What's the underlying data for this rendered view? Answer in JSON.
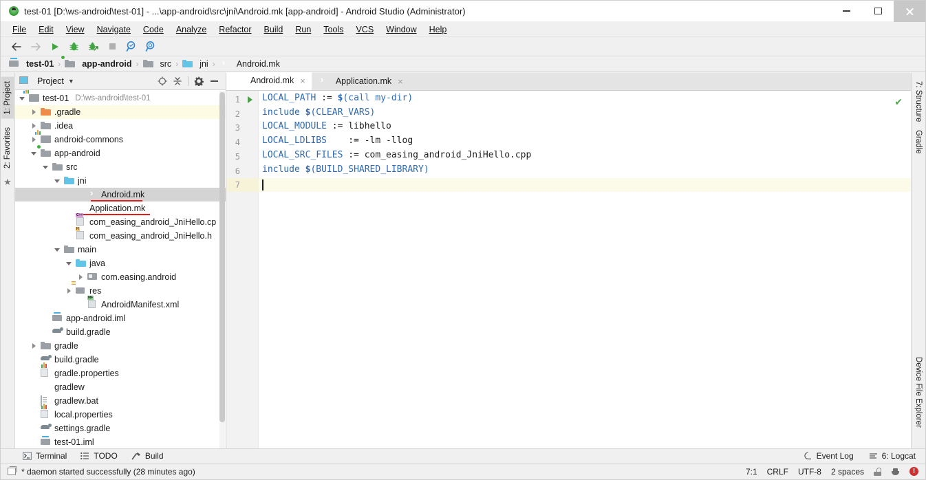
{
  "window": {
    "title": "test-01 [D:\\ws-android\\test-01] - ...\\app-android\\src\\jni\\Android.mk [app-android] - Android Studio (Administrator)",
    "app_icon": "android-studio-icon",
    "minimize": "minimize-icon",
    "maximize": "maximize-icon",
    "close": "close-icon"
  },
  "menubar": {
    "items": [
      {
        "label": "File"
      },
      {
        "label": "Edit"
      },
      {
        "label": "View"
      },
      {
        "label": "Navigate"
      },
      {
        "label": "Code"
      },
      {
        "label": "Analyze"
      },
      {
        "label": "Refactor"
      },
      {
        "label": "Build"
      },
      {
        "label": "Run"
      },
      {
        "label": "Tools"
      },
      {
        "label": "VCS"
      },
      {
        "label": "Window"
      },
      {
        "label": "Help"
      }
    ]
  },
  "toolbar": {
    "buttons": [
      {
        "name": "back-icon"
      },
      {
        "name": "forward-icon"
      },
      {
        "name": "run-icon"
      },
      {
        "name": "debug-icon"
      },
      {
        "name": "attach-debugger-icon"
      },
      {
        "name": "stop-icon"
      },
      {
        "name": "search-icon"
      },
      {
        "name": "search-everywhere-icon"
      }
    ]
  },
  "breadcrumb": {
    "items": [
      {
        "label": "test-01",
        "icon": "module-icon",
        "bold": true
      },
      {
        "label": "app-android",
        "icon": "module-green-icon",
        "bold": true
      },
      {
        "label": "src",
        "icon": "folder-gray-icon",
        "bold": false
      },
      {
        "label": "jni",
        "icon": "folder-blue-icon",
        "bold": false
      },
      {
        "label": "Android.mk",
        "icon": "mk-file-icon",
        "bold": false
      }
    ],
    "separator": "›"
  },
  "left_strip": {
    "tabs": [
      {
        "label": "1: Project",
        "num": "1",
        "rest": ": Project",
        "active": true,
        "icon": "project-icon"
      },
      {
        "label": "2: Favorites",
        "num": "2",
        "rest": ": Favorites",
        "active": false,
        "icon": "star-icon"
      }
    ]
  },
  "right_strip": {
    "tabs": [
      {
        "label": "7: Structure",
        "num": "7",
        "rest": ": Structure",
        "icon": "structure-icon"
      },
      {
        "label": "Gradle",
        "num": "",
        "rest": "Gradle",
        "icon": "gradle-elephant-icon"
      },
      {
        "label": "Device File Explorer",
        "num": "",
        "rest": "Device File Explorer",
        "icon": "device-icon"
      }
    ]
  },
  "project_panel": {
    "header": {
      "title": "Project",
      "view_icon": "project-view-icon",
      "dropdown_icon": "chevron-down-icon",
      "locate_icon": "scroll-from-source-icon",
      "collapse_icon": "collapse-all-icon",
      "settings_icon": "gear-icon",
      "hide_icon": "hide-icon"
    },
    "tree": [
      {
        "label": "test-01",
        "sub": "D:\\ws-android\\test-01",
        "indent": 0,
        "arrow": "open",
        "icon": "module-icon",
        "state": "normal"
      },
      {
        "label": ".gradle",
        "sub": "",
        "indent": 1,
        "arrow": "closed",
        "icon": "folder-orange-icon",
        "state": "highlight"
      },
      {
        "label": ".idea",
        "sub": "",
        "indent": 1,
        "arrow": "closed",
        "icon": "folder-gray-icon",
        "state": "normal"
      },
      {
        "label": "android-commons",
        "sub": "",
        "indent": 1,
        "arrow": "closed",
        "icon": "module-icon",
        "state": "normal"
      },
      {
        "label": "app-android",
        "sub": "",
        "indent": 1,
        "arrow": "open",
        "icon": "module-green-icon",
        "state": "normal"
      },
      {
        "label": "src",
        "sub": "",
        "indent": 2,
        "arrow": "open",
        "icon": "folder-gray-icon",
        "state": "normal"
      },
      {
        "label": "jni",
        "sub": "",
        "indent": 3,
        "arrow": "open",
        "icon": "folder-blue-icon",
        "state": "normal"
      },
      {
        "label": "Android.mk",
        "sub": "",
        "indent": 5,
        "arrow": "none",
        "icon": "mk-file-icon",
        "state": "selected-underlined"
      },
      {
        "label": "Application.mk",
        "sub": "",
        "indent": 4,
        "arrow": "none",
        "icon": "mk-file-icon",
        "state": "underlined"
      },
      {
        "label": "com_easing_android_JniHello.cp",
        "sub": "",
        "indent": 4,
        "arrow": "none",
        "icon": "cpp-file-icon",
        "state": "normal"
      },
      {
        "label": "com_easing_android_JniHello.h",
        "sub": "",
        "indent": 4,
        "arrow": "none",
        "icon": "h-file-icon",
        "state": "normal"
      },
      {
        "label": "main",
        "sub": "",
        "indent": 3,
        "arrow": "open",
        "icon": "folder-gray-icon",
        "state": "normal"
      },
      {
        "label": "java",
        "sub": "",
        "indent": 4,
        "arrow": "open",
        "icon": "folder-blue-icon",
        "state": "normal"
      },
      {
        "label": "com.easing.android",
        "sub": "",
        "indent": 5,
        "arrow": "closed",
        "icon": "package-icon",
        "state": "normal"
      },
      {
        "label": "res",
        "sub": "",
        "indent": 4,
        "arrow": "closed",
        "icon": "res-folder-icon",
        "state": "normal"
      },
      {
        "label": "AndroidManifest.xml",
        "sub": "",
        "indent": 5,
        "arrow": "none",
        "icon": "manifest-file-icon",
        "state": "normal"
      },
      {
        "label": "app-android.iml",
        "sub": "",
        "indent": 2,
        "arrow": "none",
        "icon": "iml-file-icon",
        "state": "normal"
      },
      {
        "label": "build.gradle",
        "sub": "",
        "indent": 2,
        "arrow": "none",
        "icon": "gradle-file-icon",
        "state": "normal"
      },
      {
        "label": "gradle",
        "sub": "",
        "indent": 1,
        "arrow": "closed",
        "icon": "folder-gray-icon",
        "state": "normal"
      },
      {
        "label": "build.gradle",
        "sub": "",
        "indent": 1,
        "arrow": "none",
        "icon": "gradle-file-icon",
        "state": "normal"
      },
      {
        "label": "gradle.properties",
        "sub": "",
        "indent": 1,
        "arrow": "none",
        "icon": "properties-file-icon",
        "state": "normal"
      },
      {
        "label": "gradlew",
        "sub": "",
        "indent": 1,
        "arrow": "none",
        "icon": "mk-file-icon",
        "state": "normal"
      },
      {
        "label": "gradlew.bat",
        "sub": "",
        "indent": 1,
        "arrow": "none",
        "icon": "bat-file-icon",
        "state": "normal"
      },
      {
        "label": "local.properties",
        "sub": "",
        "indent": 1,
        "arrow": "none",
        "icon": "properties-file-icon",
        "state": "normal"
      },
      {
        "label": "settings.gradle",
        "sub": "",
        "indent": 1,
        "arrow": "none",
        "icon": "gradle-file-icon",
        "state": "normal"
      },
      {
        "label": "test-01.iml",
        "sub": "",
        "indent": 1,
        "arrow": "none",
        "icon": "iml-file-icon",
        "state": "normal"
      }
    ]
  },
  "editor": {
    "tabs": [
      {
        "label": "Android.mk",
        "icon": "mk-file-icon",
        "active": true,
        "close": "×"
      },
      {
        "label": "Application.mk",
        "icon": "mk-file-icon",
        "active": false,
        "close": "×"
      }
    ],
    "inspection_status": "✔",
    "current_line": 7,
    "lines": [
      {
        "num": "1",
        "runmark": true,
        "tokens": [
          {
            "t": "LOCAL_PATH",
            "c": "v"
          },
          {
            "t": " := ",
            "c": ""
          },
          {
            "t": "$",
            "c": "d"
          },
          {
            "t": "(call my-dir)",
            "c": "p"
          }
        ]
      },
      {
        "num": "2",
        "runmark": false,
        "tokens": [
          {
            "t": "include ",
            "c": "v"
          },
          {
            "t": "$",
            "c": "d"
          },
          {
            "t": "(CLEAR_VARS)",
            "c": "p"
          }
        ]
      },
      {
        "num": "3",
        "runmark": false,
        "tokens": [
          {
            "t": "LOCAL_MODULE",
            "c": "v"
          },
          {
            "t": " := libhello",
            "c": ""
          }
        ]
      },
      {
        "num": "4",
        "runmark": false,
        "tokens": [
          {
            "t": "LOCAL_LDLIBS",
            "c": "v"
          },
          {
            "t": "    := -lm -llog",
            "c": ""
          }
        ]
      },
      {
        "num": "5",
        "runmark": false,
        "tokens": [
          {
            "t": "LOCAL_SRC_FILES",
            "c": "v"
          },
          {
            "t": " := com_easing_android_JniHello.cpp",
            "c": ""
          }
        ]
      },
      {
        "num": "6",
        "runmark": false,
        "tokens": [
          {
            "t": "include ",
            "c": "v"
          },
          {
            "t": "$",
            "c": "d"
          },
          {
            "t": "(BUILD_SHARED_LIBRARY)",
            "c": "p"
          }
        ]
      },
      {
        "num": "7",
        "runmark": false,
        "tokens": []
      }
    ]
  },
  "bottom_tools": {
    "left": [
      {
        "label": "Terminal",
        "icon": "terminal-icon"
      },
      {
        "label": "TODO",
        "icon": "todo-icon"
      },
      {
        "label": "Build",
        "icon": "build-hammer-icon"
      }
    ],
    "right": [
      {
        "label": "Event Log",
        "icon": "event-log-icon"
      },
      {
        "label": "6: Logcat",
        "icon": "logcat-icon"
      }
    ]
  },
  "statusbar": {
    "message": "* daemon started successfully (28 minutes ago)",
    "message_icon": "console-icon",
    "caret_position": "7:1",
    "line_separator": "CRLF",
    "encoding": "UTF-8",
    "indent": "2 spaces",
    "lock_icon": "unlocked-icon",
    "inspection_icon": "hector-hat-icon",
    "error_icon": "error-badge-icon",
    "error_badge_text": "!"
  },
  "colors": {
    "accent_blue": "#2f6ab3",
    "selection_gray": "#d4d4d4",
    "highlight_yellow": "#fdfbe4",
    "current_line": "#fcfae8",
    "underline_red": "#e01b1b",
    "green": "#4a9e4a"
  }
}
